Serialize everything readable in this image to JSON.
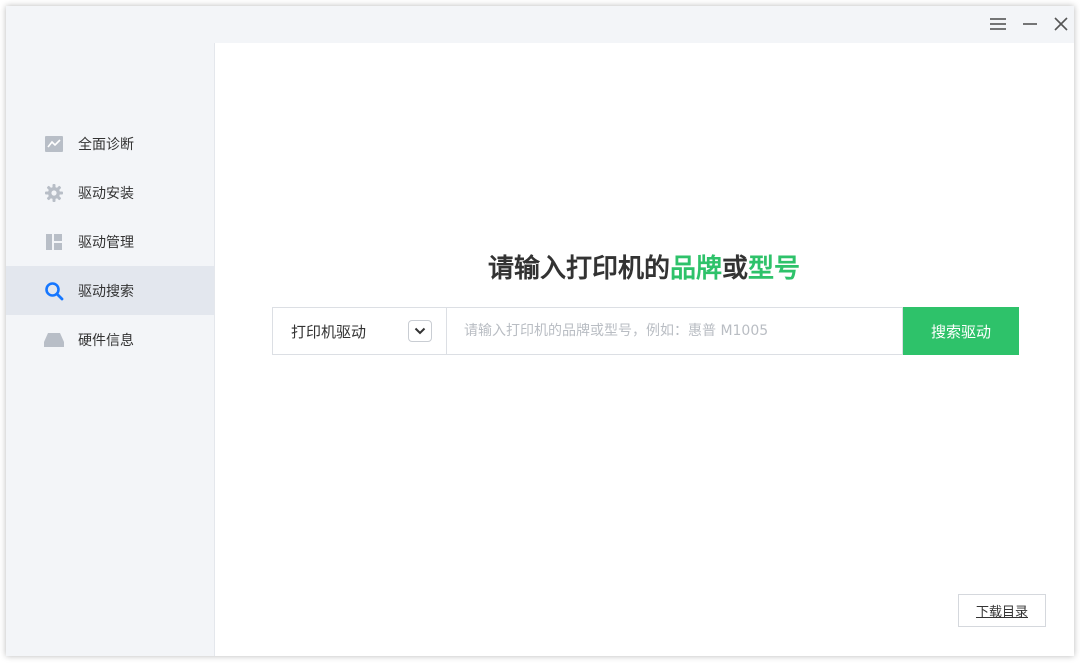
{
  "sidebar": {
    "items": [
      {
        "label": "全面诊断",
        "icon": "chart-icon"
      },
      {
        "label": "驱动安装",
        "icon": "gear-icon"
      },
      {
        "label": "驱动管理",
        "icon": "grid-icon"
      },
      {
        "label": "驱动搜索",
        "icon": "search-icon",
        "active": true
      },
      {
        "label": "硬件信息",
        "icon": "hardware-icon"
      }
    ]
  },
  "titlebar": {
    "buttons": [
      "menu-icon",
      "minimize-icon",
      "close-icon"
    ]
  },
  "main": {
    "heading_prefix": "请输入打印机的",
    "heading_hl1": "品牌",
    "heading_mid": "或",
    "heading_hl2": "型号",
    "select_value": "打印机驱动",
    "search_placeholder": "请输入打印机的品牌或型号，例如：惠普 M1005",
    "search_button": "搜索驱动",
    "download_button": "下载目录"
  },
  "colors": {
    "accent": "#2ec26a",
    "sidebar_bg": "#f3f5f8",
    "active_item_bg": "#e3e7ee",
    "active_icon": "#1677ff"
  }
}
